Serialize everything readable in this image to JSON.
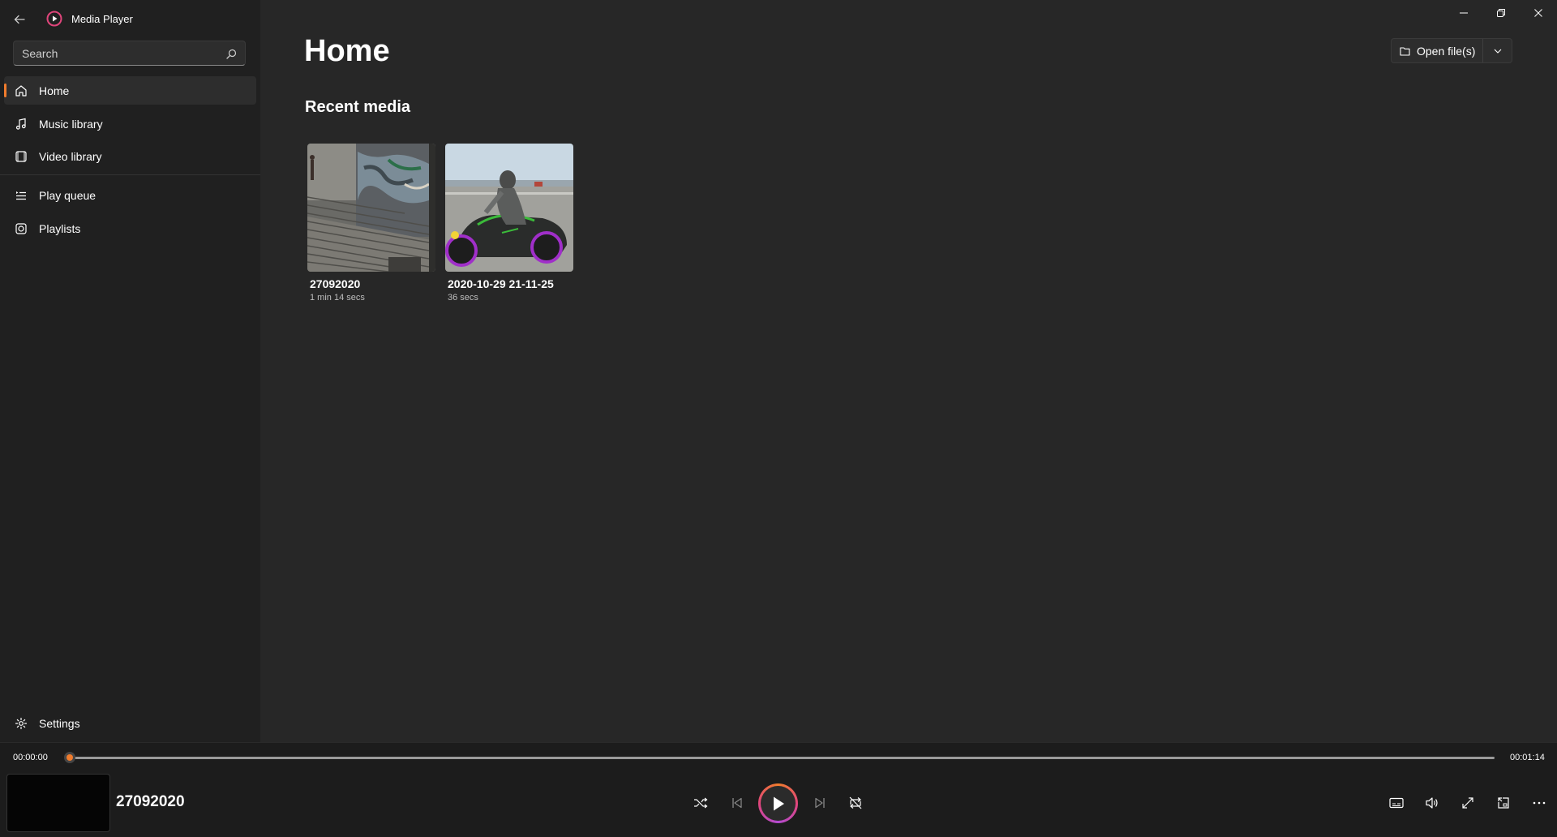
{
  "app": {
    "title": "Media Player"
  },
  "search": {
    "placeholder": "Search"
  },
  "sidebar": {
    "items": [
      {
        "label": "Home",
        "icon": "home-icon",
        "active": true
      },
      {
        "label": "Music library",
        "icon": "music-note-icon"
      },
      {
        "label": "Video library",
        "icon": "video-icon"
      },
      {
        "label": "Play queue",
        "icon": "queue-icon"
      },
      {
        "label": "Playlists",
        "icon": "playlist-icon"
      }
    ],
    "settings_label": "Settings"
  },
  "main": {
    "page_title": "Home",
    "open_files_label": "Open file(s)",
    "section_title": "Recent media",
    "recent": [
      {
        "title": "27092020",
        "duration": "1 min 14 secs"
      },
      {
        "title": "2020-10-29 21-11-25",
        "duration": "36 secs"
      }
    ]
  },
  "player": {
    "current_time": "00:00:00",
    "total_time": "00:01:14",
    "now_playing_title": "27092020",
    "progress_fraction": 0.0
  },
  "colors": {
    "accent": "#f07c2d",
    "sidebar_bg": "#202020",
    "content_bg": "#272727"
  }
}
